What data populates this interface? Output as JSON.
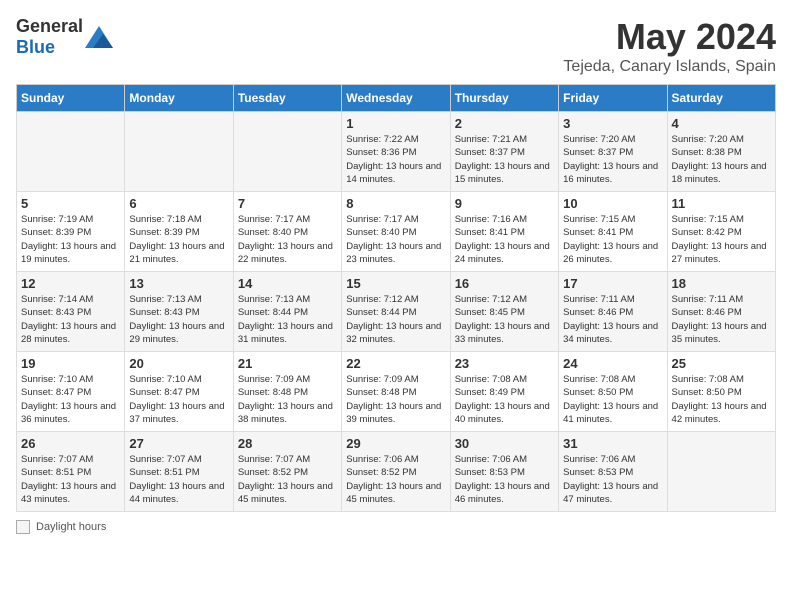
{
  "header": {
    "logo_general": "General",
    "logo_blue": "Blue",
    "title": "May 2024",
    "subtitle": "Tejeda, Canary Islands, Spain"
  },
  "footer": {
    "daylight_label": "Daylight hours"
  },
  "days_of_week": [
    "Sunday",
    "Monday",
    "Tuesday",
    "Wednesday",
    "Thursday",
    "Friday",
    "Saturday"
  ],
  "weeks": [
    [
      {
        "day": "",
        "info": ""
      },
      {
        "day": "",
        "info": ""
      },
      {
        "day": "",
        "info": ""
      },
      {
        "day": "1",
        "info": "Sunrise: 7:22 AM\nSunset: 8:36 PM\nDaylight: 13 hours and 14 minutes."
      },
      {
        "day": "2",
        "info": "Sunrise: 7:21 AM\nSunset: 8:37 PM\nDaylight: 13 hours and 15 minutes."
      },
      {
        "day": "3",
        "info": "Sunrise: 7:20 AM\nSunset: 8:37 PM\nDaylight: 13 hours and 16 minutes."
      },
      {
        "day": "4",
        "info": "Sunrise: 7:20 AM\nSunset: 8:38 PM\nDaylight: 13 hours and 18 minutes."
      }
    ],
    [
      {
        "day": "5",
        "info": "Sunrise: 7:19 AM\nSunset: 8:39 PM\nDaylight: 13 hours and 19 minutes."
      },
      {
        "day": "6",
        "info": "Sunrise: 7:18 AM\nSunset: 8:39 PM\nDaylight: 13 hours and 21 minutes."
      },
      {
        "day": "7",
        "info": "Sunrise: 7:17 AM\nSunset: 8:40 PM\nDaylight: 13 hours and 22 minutes."
      },
      {
        "day": "8",
        "info": "Sunrise: 7:17 AM\nSunset: 8:40 PM\nDaylight: 13 hours and 23 minutes."
      },
      {
        "day": "9",
        "info": "Sunrise: 7:16 AM\nSunset: 8:41 PM\nDaylight: 13 hours and 24 minutes."
      },
      {
        "day": "10",
        "info": "Sunrise: 7:15 AM\nSunset: 8:41 PM\nDaylight: 13 hours and 26 minutes."
      },
      {
        "day": "11",
        "info": "Sunrise: 7:15 AM\nSunset: 8:42 PM\nDaylight: 13 hours and 27 minutes."
      }
    ],
    [
      {
        "day": "12",
        "info": "Sunrise: 7:14 AM\nSunset: 8:43 PM\nDaylight: 13 hours and 28 minutes."
      },
      {
        "day": "13",
        "info": "Sunrise: 7:13 AM\nSunset: 8:43 PM\nDaylight: 13 hours and 29 minutes."
      },
      {
        "day": "14",
        "info": "Sunrise: 7:13 AM\nSunset: 8:44 PM\nDaylight: 13 hours and 31 minutes."
      },
      {
        "day": "15",
        "info": "Sunrise: 7:12 AM\nSunset: 8:44 PM\nDaylight: 13 hours and 32 minutes."
      },
      {
        "day": "16",
        "info": "Sunrise: 7:12 AM\nSunset: 8:45 PM\nDaylight: 13 hours and 33 minutes."
      },
      {
        "day": "17",
        "info": "Sunrise: 7:11 AM\nSunset: 8:46 PM\nDaylight: 13 hours and 34 minutes."
      },
      {
        "day": "18",
        "info": "Sunrise: 7:11 AM\nSunset: 8:46 PM\nDaylight: 13 hours and 35 minutes."
      }
    ],
    [
      {
        "day": "19",
        "info": "Sunrise: 7:10 AM\nSunset: 8:47 PM\nDaylight: 13 hours and 36 minutes."
      },
      {
        "day": "20",
        "info": "Sunrise: 7:10 AM\nSunset: 8:47 PM\nDaylight: 13 hours and 37 minutes."
      },
      {
        "day": "21",
        "info": "Sunrise: 7:09 AM\nSunset: 8:48 PM\nDaylight: 13 hours and 38 minutes."
      },
      {
        "day": "22",
        "info": "Sunrise: 7:09 AM\nSunset: 8:48 PM\nDaylight: 13 hours and 39 minutes."
      },
      {
        "day": "23",
        "info": "Sunrise: 7:08 AM\nSunset: 8:49 PM\nDaylight: 13 hours and 40 minutes."
      },
      {
        "day": "24",
        "info": "Sunrise: 7:08 AM\nSunset: 8:50 PM\nDaylight: 13 hours and 41 minutes."
      },
      {
        "day": "25",
        "info": "Sunrise: 7:08 AM\nSunset: 8:50 PM\nDaylight: 13 hours and 42 minutes."
      }
    ],
    [
      {
        "day": "26",
        "info": "Sunrise: 7:07 AM\nSunset: 8:51 PM\nDaylight: 13 hours and 43 minutes."
      },
      {
        "day": "27",
        "info": "Sunrise: 7:07 AM\nSunset: 8:51 PM\nDaylight: 13 hours and 44 minutes."
      },
      {
        "day": "28",
        "info": "Sunrise: 7:07 AM\nSunset: 8:52 PM\nDaylight: 13 hours and 45 minutes."
      },
      {
        "day": "29",
        "info": "Sunrise: 7:06 AM\nSunset: 8:52 PM\nDaylight: 13 hours and 45 minutes."
      },
      {
        "day": "30",
        "info": "Sunrise: 7:06 AM\nSunset: 8:53 PM\nDaylight: 13 hours and 46 minutes."
      },
      {
        "day": "31",
        "info": "Sunrise: 7:06 AM\nSunset: 8:53 PM\nDaylight: 13 hours and 47 minutes."
      },
      {
        "day": "",
        "info": ""
      }
    ]
  ]
}
